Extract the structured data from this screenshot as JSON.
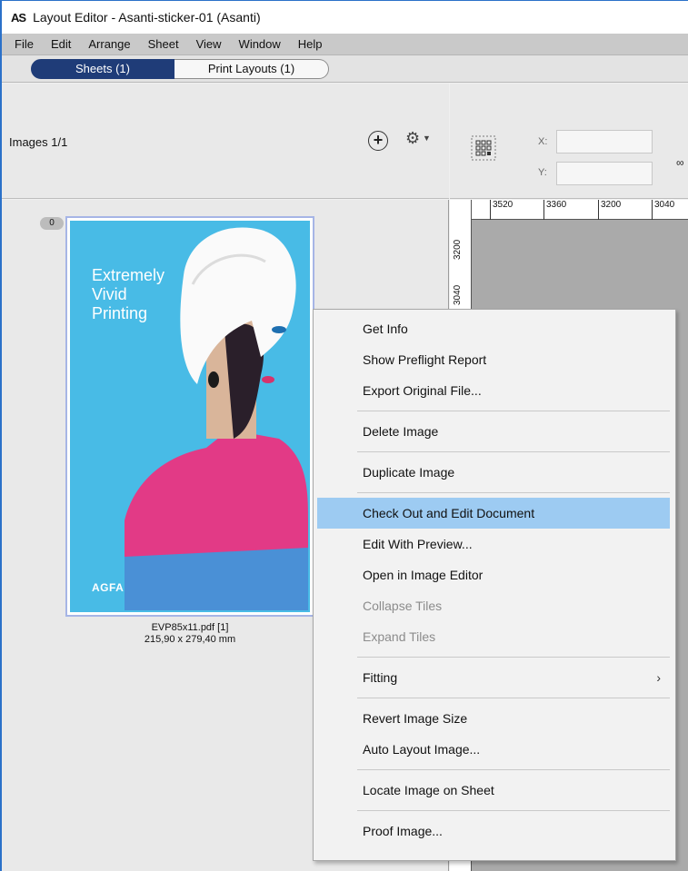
{
  "window": {
    "logo": "AS",
    "title": "Layout Editor - Asanti-sticker-01 (Asanti)"
  },
  "menubar": [
    "File",
    "Edit",
    "Arrange",
    "Sheet",
    "View",
    "Window",
    "Help"
  ],
  "tabs": {
    "sheets": "Sheets (1)",
    "print_layouts": "Print Layouts (1)"
  },
  "images_panel": {
    "count_label": "Images 1/1",
    "badge": "0",
    "thumbnail_text": [
      "Extremely",
      "Vivid",
      "Printing"
    ],
    "thumbnail_logo": "AGFA",
    "file_name": "EVP85x11.pdf [1]",
    "file_size": "215,90 x 279,40 mm"
  },
  "position_fields": {
    "x_label": "X:",
    "y_label": "Y:"
  },
  "ruler": {
    "top": [
      "3520",
      "3360",
      "3200",
      "3040"
    ],
    "left": [
      "3200",
      "3040"
    ]
  },
  "context_menu": {
    "groups": [
      [
        "Get Info",
        "Show Preflight Report",
        "Export Original File..."
      ],
      [
        "Delete Image"
      ],
      [
        "Duplicate Image"
      ],
      [
        "Check Out and Edit Document",
        "Edit With Preview...",
        "Open in Image Editor",
        "Collapse Tiles",
        "Expand Tiles"
      ],
      [
        "Fitting"
      ],
      [
        "Revert Image Size",
        "Auto Layout Image..."
      ],
      [
        "Locate Image on Sheet"
      ],
      [
        "Proof Image..."
      ]
    ],
    "highlighted": "Check Out and Edit Document",
    "disabled": [
      "Collapse Tiles",
      "Expand Tiles"
    ],
    "submenu": [
      "Fitting"
    ]
  },
  "colors": {
    "accent_tab": "#1f3c78",
    "menu_highlight": "#9dcbf2",
    "thumbnail_bg": "#48bbe6"
  }
}
